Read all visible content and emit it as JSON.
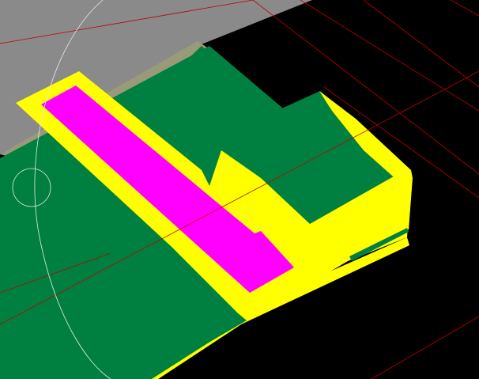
{
  "viewport": {
    "background": "#000000"
  },
  "scene": {
    "colors": {
      "background_plate": "#8a8a8a",
      "background_plate_edge": "#9a9a7a",
      "copper_top": "#008040",
      "copper_side": "#006a34",
      "keepout_yellow": "#ffff00",
      "highlight_magenta": "#ff00ff",
      "guide_lines": "#c00000",
      "cursor_circle": "#e8e8e8"
    },
    "layers": [
      "background-plate",
      "copper-pour",
      "yellow-outline-region",
      "magenta-selected-region",
      "red-guide-lines",
      "cursor-arc"
    ]
  }
}
